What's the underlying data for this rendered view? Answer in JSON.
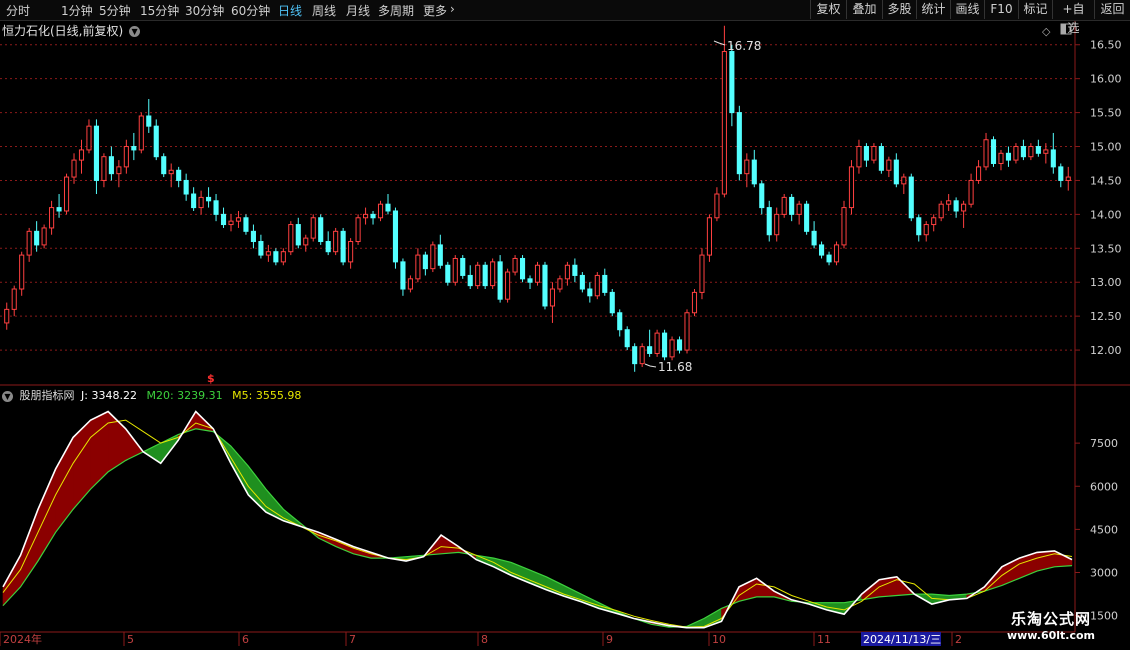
{
  "toolbar": {
    "periods": [
      "分时",
      "1分钟",
      "5分钟",
      "15分钟",
      "30分钟",
      "60分钟",
      "日线",
      "周线",
      "月线",
      "多周期",
      "更多"
    ],
    "active_period": "日线",
    "more_arrow": "›",
    "right_buttons": [
      "复权",
      "叠加",
      "多股",
      "统计",
      "画线",
      "F10",
      "标记",
      "+自选",
      "返回"
    ]
  },
  "main_chart": {
    "title": "恒力石化(日线,前复权)",
    "high_label": "16.78",
    "low_label": "11.68",
    "y_ticks": [
      "16.50",
      "16.00",
      "15.50",
      "15.00",
      "14.50",
      "14.00",
      "13.50",
      "13.00",
      "12.50",
      "12.00"
    ],
    "marker_glyph": "$",
    "up_color": "#ff4040",
    "down_color": "#54ffff"
  },
  "indicator": {
    "name": "股朋指标网",
    "j_label": "J:",
    "j_value": "3348.22",
    "m20_label": "M20:",
    "m20_value": "3239.31",
    "m5_label": "M5:",
    "m5_value": "3555.98",
    "y_ticks": [
      "7500",
      "6000",
      "4500",
      "3000",
      "1500"
    ],
    "j_color": "#ffffff",
    "m20_color": "#3dd13d",
    "m5_color": "#e6e600",
    "fill_up": "#8b0000",
    "fill_down": "#1f8f1f"
  },
  "x_axis": {
    "labels": [
      "2024年",
      "5",
      "6",
      "7",
      "8",
      "9",
      "10",
      "11",
      "2"
    ],
    "cursor_date": "2024/11/13/三"
  },
  "watermark": {
    "line1": "乐淘公式网",
    "line2": "www.60lt.com"
  },
  "chart_data": {
    "type": "candlestick+indicator",
    "title": "恒力石化(日线,前复权)",
    "price_ylim": [
      11.5,
      16.85
    ],
    "candles_ohlc": [
      [
        12.4,
        12.7,
        12.3,
        12.6
      ],
      [
        12.6,
        12.95,
        12.5,
        12.9
      ],
      [
        12.9,
        13.45,
        12.8,
        13.4
      ],
      [
        13.4,
        13.8,
        13.3,
        13.75
      ],
      [
        13.75,
        13.9,
        13.45,
        13.55
      ],
      [
        13.55,
        13.85,
        13.5,
        13.8
      ],
      [
        13.8,
        14.2,
        13.7,
        14.1
      ],
      [
        14.1,
        14.3,
        13.95,
        14.05
      ],
      [
        14.05,
        14.6,
        14.0,
        14.55
      ],
      [
        14.55,
        14.9,
        14.45,
        14.8
      ],
      [
        14.8,
        15.1,
        14.6,
        14.95
      ],
      [
        14.95,
        15.4,
        14.9,
        15.3
      ],
      [
        15.3,
        15.4,
        14.3,
        14.5
      ],
      [
        14.5,
        14.9,
        14.4,
        14.85
      ],
      [
        14.85,
        15.0,
        14.5,
        14.6
      ],
      [
        14.6,
        14.8,
        14.4,
        14.7
      ],
      [
        14.7,
        15.1,
        14.6,
        15.0
      ],
      [
        15.0,
        15.2,
        14.8,
        14.95
      ],
      [
        14.95,
        15.5,
        14.9,
        15.45
      ],
      [
        15.45,
        15.7,
        15.2,
        15.3
      ],
      [
        15.3,
        15.4,
        14.8,
        14.85
      ],
      [
        14.85,
        14.9,
        14.55,
        14.6
      ],
      [
        14.6,
        14.75,
        14.4,
        14.65
      ],
      [
        14.65,
        14.7,
        14.4,
        14.5
      ],
      [
        14.5,
        14.6,
        14.2,
        14.3
      ],
      [
        14.3,
        14.4,
        14.05,
        14.1
      ],
      [
        14.1,
        14.35,
        14.0,
        14.25
      ],
      [
        14.25,
        14.4,
        14.1,
        14.2
      ],
      [
        14.2,
        14.3,
        13.9,
        14.0
      ],
      [
        14.0,
        14.1,
        13.8,
        13.85
      ],
      [
        13.85,
        14.0,
        13.75,
        13.9
      ],
      [
        13.9,
        14.05,
        13.8,
        13.95
      ],
      [
        13.95,
        14.0,
        13.7,
        13.75
      ],
      [
        13.75,
        13.85,
        13.5,
        13.6
      ],
      [
        13.6,
        13.7,
        13.35,
        13.4
      ],
      [
        13.4,
        13.55,
        13.3,
        13.45
      ],
      [
        13.45,
        13.5,
        13.25,
        13.3
      ],
      [
        13.3,
        13.5,
        13.25,
        13.45
      ],
      [
        13.45,
        13.9,
        13.4,
        13.85
      ],
      [
        13.85,
        13.95,
        13.5,
        13.55
      ],
      [
        13.55,
        13.7,
        13.45,
        13.65
      ],
      [
        13.65,
        14.0,
        13.6,
        13.95
      ],
      [
        13.95,
        14.0,
        13.55,
        13.6
      ],
      [
        13.6,
        13.75,
        13.4,
        13.45
      ],
      [
        13.45,
        13.8,
        13.4,
        13.75
      ],
      [
        13.75,
        13.8,
        13.25,
        13.3
      ],
      [
        13.3,
        13.65,
        13.2,
        13.6
      ],
      [
        13.6,
        14.0,
        13.55,
        13.95
      ],
      [
        13.95,
        14.1,
        13.85,
        14.0
      ],
      [
        14.0,
        14.05,
        13.85,
        13.95
      ],
      [
        13.95,
        14.2,
        13.9,
        14.15
      ],
      [
        14.15,
        14.3,
        14.0,
        14.05
      ],
      [
        14.05,
        14.1,
        13.2,
        13.3
      ],
      [
        13.3,
        13.35,
        12.8,
        12.9
      ],
      [
        12.9,
        13.1,
        12.85,
        13.05
      ],
      [
        13.05,
        13.5,
        13.0,
        13.4
      ],
      [
        13.4,
        13.45,
        13.1,
        13.2
      ],
      [
        13.2,
        13.6,
        13.15,
        13.55
      ],
      [
        13.55,
        13.7,
        13.2,
        13.25
      ],
      [
        13.25,
        13.3,
        12.95,
        13.0
      ],
      [
        13.0,
        13.4,
        12.95,
        13.35
      ],
      [
        13.35,
        13.4,
        13.05,
        13.1
      ],
      [
        13.1,
        13.25,
        12.9,
        12.95
      ],
      [
        12.95,
        13.3,
        12.9,
        13.25
      ],
      [
        13.25,
        13.3,
        12.9,
        12.95
      ],
      [
        12.95,
        13.35,
        12.9,
        13.3
      ],
      [
        13.3,
        13.4,
        12.7,
        12.75
      ],
      [
        12.75,
        13.2,
        12.7,
        13.15
      ],
      [
        13.15,
        13.4,
        13.1,
        13.35
      ],
      [
        13.35,
        13.4,
        13.0,
        13.05
      ],
      [
        13.05,
        13.1,
        12.9,
        13.0
      ],
      [
        13.0,
        13.3,
        12.95,
        13.25
      ],
      [
        13.25,
        13.3,
        12.6,
        12.65
      ],
      [
        12.65,
        13.0,
        12.4,
        12.9
      ],
      [
        12.9,
        13.1,
        12.85,
        13.05
      ],
      [
        13.05,
        13.3,
        12.95,
        13.25
      ],
      [
        13.25,
        13.35,
        13.0,
        13.1
      ],
      [
        13.1,
        13.15,
        12.85,
        12.9
      ],
      [
        12.9,
        13.0,
        12.7,
        12.8
      ],
      [
        12.8,
        13.15,
        12.75,
        13.1
      ],
      [
        13.1,
        13.2,
        12.8,
        12.85
      ],
      [
        12.85,
        12.9,
        12.5,
        12.55
      ],
      [
        12.55,
        12.6,
        12.2,
        12.3
      ],
      [
        12.3,
        12.35,
        12.0,
        12.05
      ],
      [
        12.05,
        12.1,
        11.68,
        11.8
      ],
      [
        11.8,
        12.1,
        11.75,
        12.05
      ],
      [
        12.05,
        12.3,
        11.9,
        11.95
      ],
      [
        11.95,
        12.3,
        11.9,
        12.25
      ],
      [
        12.25,
        12.3,
        11.85,
        11.9
      ],
      [
        11.9,
        12.2,
        11.85,
        12.15
      ],
      [
        12.15,
        12.2,
        11.95,
        12.0
      ],
      [
        12.0,
        12.6,
        11.95,
        12.55
      ],
      [
        12.55,
        12.9,
        12.5,
        12.85
      ],
      [
        12.85,
        13.5,
        12.75,
        13.4
      ],
      [
        13.4,
        14.0,
        13.3,
        13.95
      ],
      [
        13.95,
        14.4,
        13.9,
        14.3
      ],
      [
        14.3,
        16.78,
        14.25,
        16.4
      ],
      [
        16.4,
        16.5,
        15.3,
        15.5
      ],
      [
        15.5,
        15.6,
        14.5,
        14.6
      ],
      [
        14.6,
        14.9,
        14.4,
        14.8
      ],
      [
        14.8,
        14.95,
        14.4,
        14.45
      ],
      [
        14.45,
        14.5,
        14.0,
        14.1
      ],
      [
        14.1,
        14.2,
        13.6,
        13.7
      ],
      [
        13.7,
        14.1,
        13.6,
        14.0
      ],
      [
        14.0,
        14.3,
        13.95,
        14.25
      ],
      [
        14.25,
        14.3,
        13.9,
        14.0
      ],
      [
        14.0,
        14.2,
        13.85,
        14.15
      ],
      [
        14.15,
        14.2,
        13.7,
        13.75
      ],
      [
        13.75,
        13.9,
        13.5,
        13.55
      ],
      [
        13.55,
        13.6,
        13.35,
        13.4
      ],
      [
        13.4,
        13.45,
        13.25,
        13.3
      ],
      [
        13.3,
        13.6,
        13.25,
        13.55
      ],
      [
        13.55,
        14.2,
        13.5,
        14.1
      ],
      [
        14.1,
        14.8,
        14.0,
        14.7
      ],
      [
        14.7,
        15.1,
        14.6,
        15.0
      ],
      [
        15.0,
        15.05,
        14.7,
        14.8
      ],
      [
        14.8,
        15.05,
        14.75,
        15.0
      ],
      [
        15.0,
        15.05,
        14.6,
        14.65
      ],
      [
        14.65,
        14.85,
        14.55,
        14.8
      ],
      [
        14.8,
        14.9,
        14.4,
        14.45
      ],
      [
        14.45,
        14.6,
        14.3,
        14.55
      ],
      [
        14.55,
        14.6,
        13.9,
        13.95
      ],
      [
        13.95,
        14.0,
        13.6,
        13.7
      ],
      [
        13.7,
        13.9,
        13.6,
        13.85
      ],
      [
        13.85,
        14.0,
        13.75,
        13.95
      ],
      [
        13.95,
        14.2,
        13.9,
        14.15
      ],
      [
        14.15,
        14.3,
        14.05,
        14.2
      ],
      [
        14.2,
        14.25,
        13.95,
        14.05
      ],
      [
        14.05,
        14.2,
        13.8,
        14.15
      ],
      [
        14.15,
        14.6,
        14.1,
        14.5
      ],
      [
        14.5,
        14.8,
        14.45,
        14.7
      ],
      [
        14.7,
        15.2,
        14.65,
        15.1
      ],
      [
        15.1,
        15.15,
        14.7,
        14.75
      ],
      [
        14.75,
        14.95,
        14.65,
        14.9
      ],
      [
        14.9,
        15.0,
        14.7,
        14.8
      ],
      [
        14.8,
        15.05,
        14.75,
        15.0
      ],
      [
        15.0,
        15.1,
        14.8,
        14.85
      ],
      [
        14.85,
        15.05,
        14.8,
        15.0
      ],
      [
        15.0,
        15.1,
        14.85,
        14.9
      ],
      [
        14.9,
        15.05,
        14.75,
        14.95
      ],
      [
        14.95,
        15.2,
        14.6,
        14.7
      ],
      [
        14.7,
        14.75,
        14.4,
        14.5
      ],
      [
        14.5,
        14.7,
        14.35,
        14.55
      ]
    ],
    "indicator_ylim": [
      1000,
      9000
    ],
    "indicator_series": [
      {
        "name": "J",
        "values": [
          2500,
          3600,
          5200,
          6600,
          7700,
          8300,
          8600,
          8000,
          7200,
          6800,
          7600,
          8600,
          8000,
          6800,
          5700,
          5100,
          4800,
          4600,
          4400,
          4150,
          3900,
          3700,
          3500,
          3400,
          3550,
          4300,
          3900,
          3450,
          3200,
          2900,
          2650,
          2400,
          2180,
          1980,
          1750,
          1580,
          1400,
          1270,
          1150,
          1080,
          1080,
          1300,
          2500,
          2800,
          2350,
          2050,
          1900,
          1700,
          1550,
          2250,
          2750,
          2850,
          2250,
          1900,
          2050,
          2100,
          2500,
          3200,
          3500,
          3700,
          3750,
          3450
        ]
      },
      {
        "name": "M20",
        "values": [
          1850,
          2500,
          3400,
          4400,
          5200,
          5900,
          6500,
          6900,
          7200,
          7500,
          7800,
          8000,
          7900,
          7400,
          6700,
          5900,
          5200,
          4700,
          4200,
          3900,
          3650,
          3500,
          3500,
          3550,
          3600,
          3650,
          3700,
          3600,
          3500,
          3350,
          3100,
          2850,
          2550,
          2250,
          1950,
          1650,
          1400,
          1200,
          1100,
          1120,
          1400,
          1750,
          2000,
          2150,
          2150,
          2000,
          1950,
          1950,
          1950,
          2050,
          2150,
          2200,
          2250,
          2250,
          2200,
          2250,
          2350,
          2550,
          2800,
          3050,
          3200,
          3240
        ]
      },
      {
        "name": "M5",
        "values": [
          2300,
          3100,
          4400,
          5700,
          6800,
          7700,
          8200,
          8300,
          7900,
          7500,
          7700,
          8200,
          8000,
          7000,
          6000,
          5300,
          4900,
          4600,
          4300,
          4100,
          3850,
          3650,
          3500,
          3450,
          3550,
          3900,
          3850,
          3600,
          3350,
          3000,
          2750,
          2500,
          2250,
          2050,
          1850,
          1680,
          1480,
          1330,
          1200,
          1100,
          1120,
          1400,
          2200,
          2600,
          2500,
          2200,
          2000,
          1800,
          1700,
          2000,
          2500,
          2750,
          2600,
          2100,
          2050,
          2100,
          2350,
          2900,
          3300,
          3500,
          3650,
          3556
        ]
      }
    ],
    "x_labels": [
      "2024年",
      "5",
      "6",
      "7",
      "8",
      "9",
      "10",
      "11",
      "2"
    ]
  }
}
